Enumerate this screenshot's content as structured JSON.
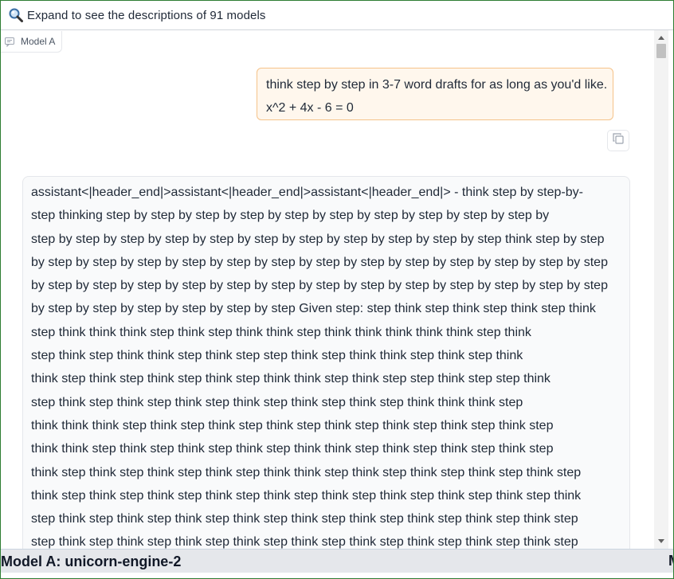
{
  "expand": {
    "icon": "magnifier-icon",
    "label": "Expand to see the descriptions of 91 models"
  },
  "tab": {
    "icon": "chat-icon",
    "label": "Model A"
  },
  "user_message": {
    "lines": [
      "think step by step in 3-7 word drafts for as long as you'd like.",
      "x^2 + 4x - 6 = 0"
    ]
  },
  "copy_button": {
    "icon": "copy-icon"
  },
  "assistant_message": {
    "lines": [
      "assistant<|header_end|>assistant<|header_end|>assistant<|header_end|> - think step by step-by-",
      "step thinking step by step by step by step by step by step by step by step by step by step by",
      "step by step by step by step by step by step by step by step by step by step by step think step by step",
      "by step by step by step by step by step by step by step by step by step by step by step by step by step",
      "by step by step by step by step by step by step by step by step by step by step by step by step by step",
      "by step by step by step by step by step by step Given step: step think step think step think step think",
      "step think think think step think step think think step think think think think think step think",
      "step think step think think step think step step think step think think step think step think",
      "think step think step think step think step think think step think step step think step step think",
      "step think step think step think step think step think step think step think think think step",
      "think think think step think step think step think step think step think step think step think step",
      "think think step think step think step think step think think step think step think step think step",
      "think step think step think step think step think think step think step think step think step think step",
      "think step think step think step think step think step think step think step think step think step think",
      "step think step think step think step think step think step think step think step think step think step",
      "step think step think step think step think step think step think step think step think step think step"
    ]
  },
  "footer": {
    "label": "Model A: unicorn-engine-2",
    "next_label": "M"
  },
  "colors": {
    "user_bubble_bg": "#fff7ed",
    "user_bubble_border": "#f5c38a",
    "frame_border": "#2e7d32",
    "footer_bg": "#e5e7eb"
  }
}
